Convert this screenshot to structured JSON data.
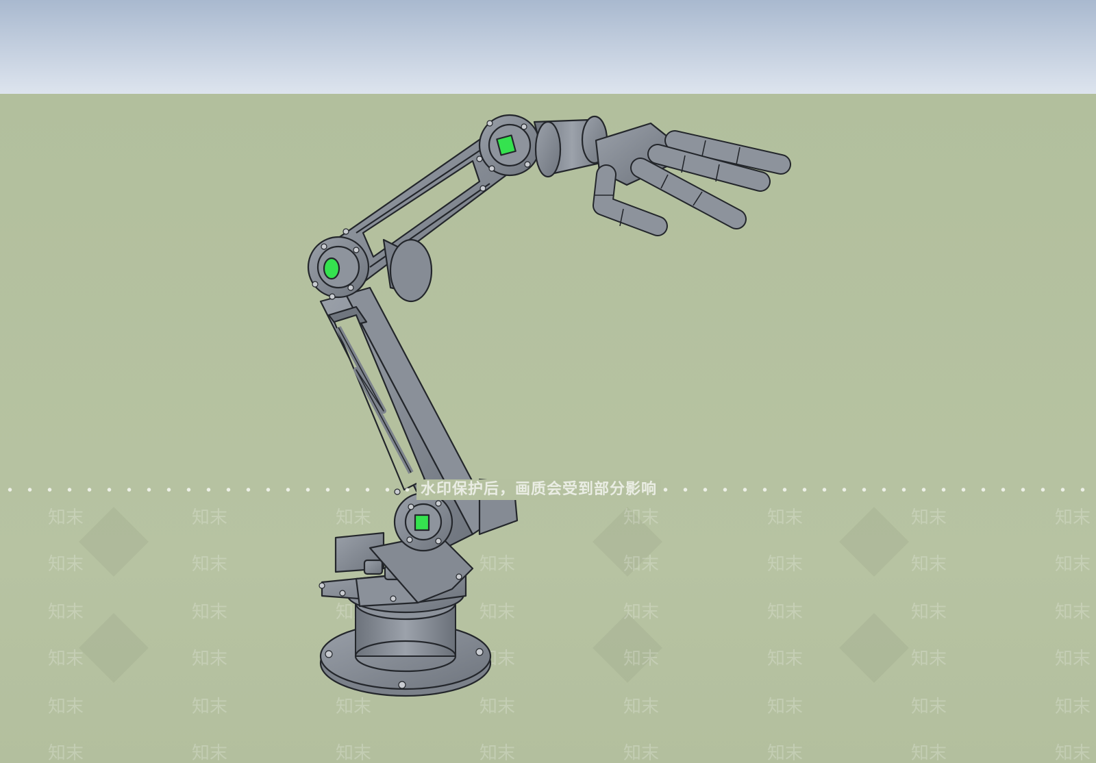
{
  "scene": {
    "subject": "robotic arm with mechanical hand",
    "colors": {
      "sky_top": "#a9b9cf",
      "sky_bottom": "#dde4ee",
      "ground": "#b4c09e",
      "metal": "#7c828c",
      "metal_light": "#9ba1aa",
      "edge": "#23262b",
      "joint_light": "#35e24f"
    }
  },
  "watermark": {
    "banner_text": "水印保护后，画质会受到部分影响",
    "mark_text": "知末"
  }
}
